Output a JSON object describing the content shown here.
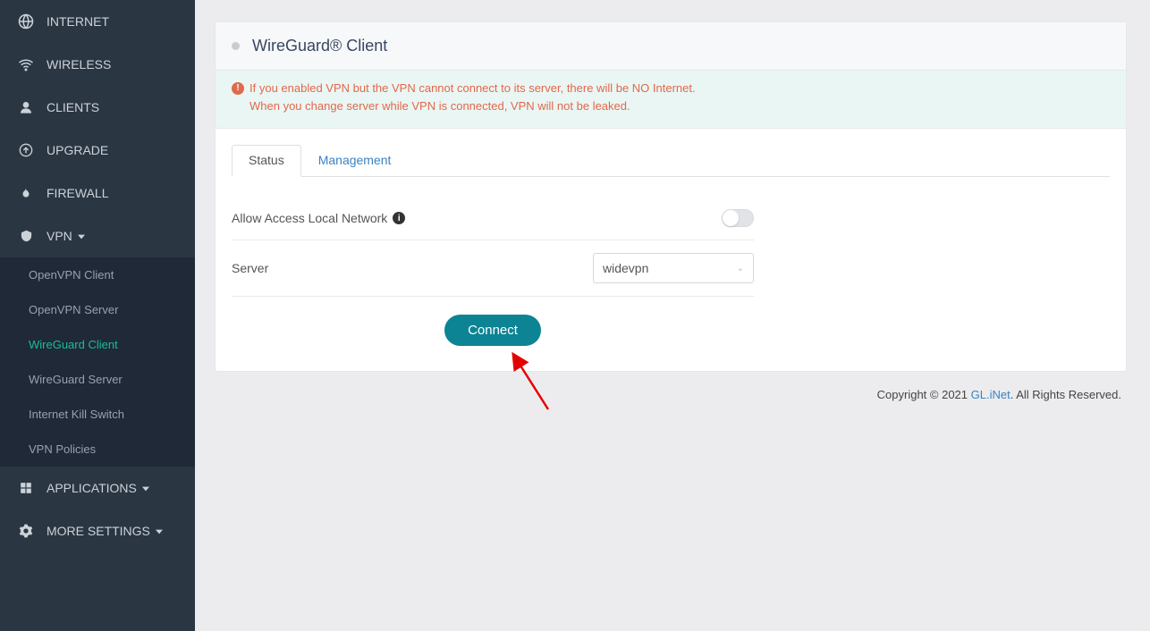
{
  "sidebar": {
    "items": [
      {
        "label": "INTERNET",
        "icon": "globe"
      },
      {
        "label": "WIRELESS",
        "icon": "wifi"
      },
      {
        "label": "CLIENTS",
        "icon": "user"
      },
      {
        "label": "UPGRADE",
        "icon": "upload"
      },
      {
        "label": "FIREWALL",
        "icon": "flame"
      },
      {
        "label": "VPN",
        "icon": "shield",
        "caret": true
      }
    ],
    "vpn_sub": [
      {
        "label": "OpenVPN Client"
      },
      {
        "label": "OpenVPN Server"
      },
      {
        "label": "WireGuard Client",
        "active": true
      },
      {
        "label": "WireGuard Server"
      },
      {
        "label": "Internet Kill Switch"
      },
      {
        "label": "VPN Policies"
      }
    ],
    "after": [
      {
        "label": "APPLICATIONS",
        "icon": "grid",
        "caret": true
      },
      {
        "label": "MORE SETTINGS",
        "icon": "gear",
        "caret": true
      }
    ]
  },
  "panel": {
    "title": "WireGuard® Client",
    "alert_line1": "If you enabled VPN but the VPN cannot connect to its server, there will be NO Internet.",
    "alert_line2": "When you change server while VPN is connected, VPN will not be leaked.",
    "tabs": {
      "status": "Status",
      "management": "Management"
    },
    "allow_label": "Allow Access Local Network",
    "server_label": "Server",
    "server_value": "widevpn",
    "connect_label": "Connect"
  },
  "footer": {
    "copyright_prefix": "Copyright © 2021 ",
    "link": "GL.iNet",
    "suffix": ". All Rights Reserved."
  }
}
